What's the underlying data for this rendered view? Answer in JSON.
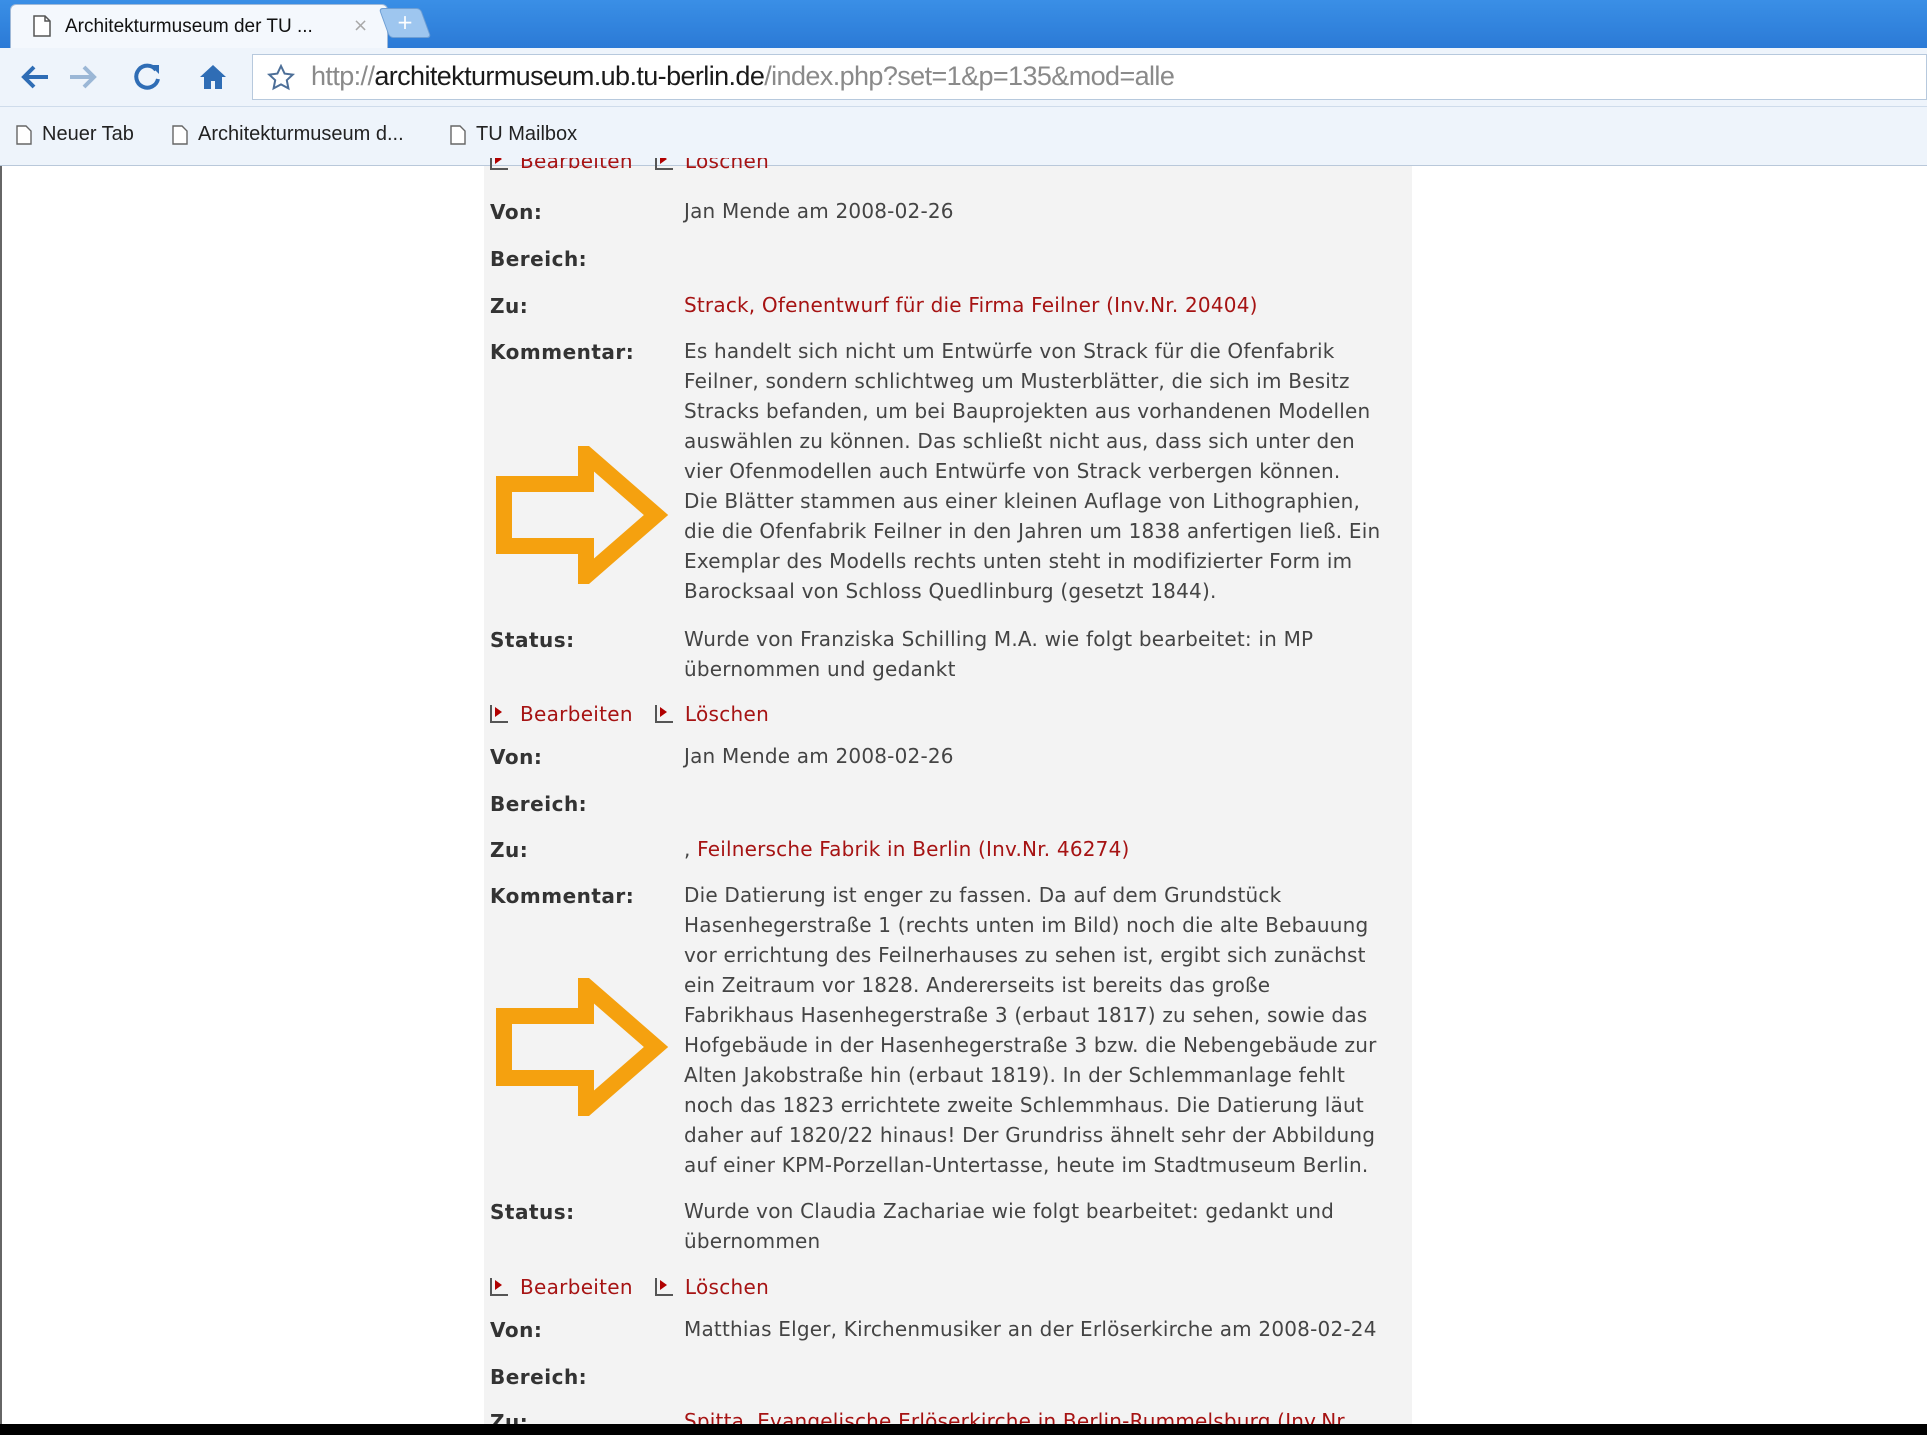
{
  "browser": {
    "tab_title": "Architekturmuseum der TU ...",
    "tab_close": "×",
    "new_tab": "+",
    "url_prefix": "http://",
    "url_host": "architekturmuseum.ub.tu-berlin.de",
    "url_path": "/index.php?set=1&p=135&mod=alle",
    "bookmarks": [
      "Neuer Tab",
      "Architekturmuseum d...",
      "TU Mailbox"
    ]
  },
  "labels": {
    "von": "Von:",
    "bereich": "Bereich:",
    "zu": "Zu:",
    "kommentar": "Kommentar:",
    "status": "Status:",
    "edit": "Bearbeiten",
    "delete": "Löschen"
  },
  "entries": [
    {
      "von": "Jan Mende am 2008-02-26",
      "zu_link": "Strack, Ofenentwurf für die Firma Feilner (Inv.Nr. 20404)",
      "kommentar": [
        "Es handelt sich nicht um Entwürfe von Strack für die Ofenfabrik",
        "Feilner, sondern schlichtweg um Musterblätter, die sich im Besitz",
        "Stracks befanden, um bei Bauprojekten aus vorhandenen Modellen",
        "auswählen zu können. Das schließt nicht aus, dass sich unter den",
        "vier Ofenmodellen auch Entwürfe von Strack verbergen können.",
        "Die Blätter stammen aus einer kleinen Auflage von Lithographien,",
        "die die Ofenfabrik Feilner in den Jahren um 1838 anfertigen ließ. Ein",
        "Exemplar des Modells rechts unten steht in modifizierter Form im",
        "Barocksaal von Schloss Quedlinburg (gesetzt 1844)."
      ],
      "status": [
        "Wurde von Franziska Schilling M.A. wie folgt bearbeitet: in MP",
        "übernommen und gedankt"
      ]
    },
    {
      "von": "Jan Mende am 2008-02-26",
      "zu_prefix": ",",
      "zu_link": "Feilnersche Fabrik in Berlin (Inv.Nr. 46274)",
      "kommentar": [
        "Die Datierung ist enger zu fassen. Da auf dem Grundstück",
        "Hasenhegerstraße 1 (rechts unten im Bild) noch die alte Bebauung",
        "vor errichtung des Feilnerhauses zu sehen ist, ergibt sich zunächst",
        "ein Zeitraum vor 1828. Andererseits ist bereits das große",
        "Fabrikhaus Hasenhegerstraße 3 (erbaut 1817) zu sehen, sowie das",
        "Hofgebäude in der Hasenhegerstraße 3 bzw. die Nebengebäude zur",
        "Alten Jakobstraße hin (erbaut 1819). In der Schlemmanlage fehlt",
        "noch das 1823 errichtete zweite Schlemmhaus. Die Datierung läut",
        "daher auf 1820/22 hinaus! Der Grundriss ähnelt sehr der Abbildung",
        "auf einer KPM-Porzellan-Untertasse, heute im Stadtmuseum Berlin."
      ],
      "status": [
        "Wurde von Claudia Zachariae wie folgt bearbeitet: gedankt und",
        "übernommen"
      ]
    },
    {
      "von": "Matthias Elger, Kirchenmusiker an der Erlöserkirche am 2008-02-24",
      "zu_link": "Spitta, Evangelische Erlöserkirche in Berlin-Rummelsburg (Inv.Nr."
    }
  ],
  "colors": {
    "link": "#a61313",
    "arrow": "#f5a10f",
    "panel": "#f3f3f3"
  }
}
